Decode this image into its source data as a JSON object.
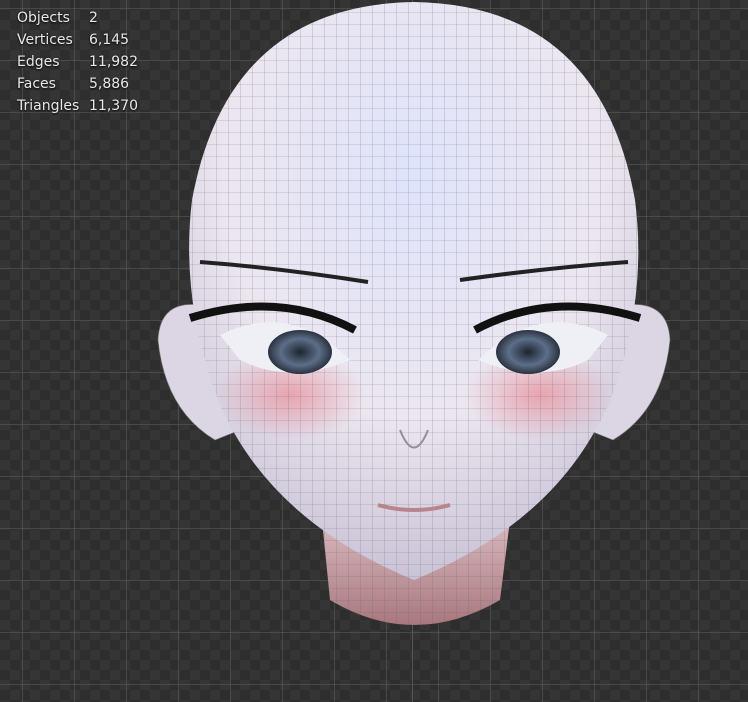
{
  "stats": [
    {
      "label": "Objects",
      "value": "2"
    },
    {
      "label": "Vertices",
      "value": "6,145"
    },
    {
      "label": "Edges",
      "value": "11,982"
    },
    {
      "label": "Faces",
      "value": "5,886"
    },
    {
      "label": "Triangles",
      "value": "11,370"
    }
  ],
  "colors": {
    "skin": "#e9e6f2",
    "blush": "#e8a0a8",
    "wire": "#555a66"
  }
}
